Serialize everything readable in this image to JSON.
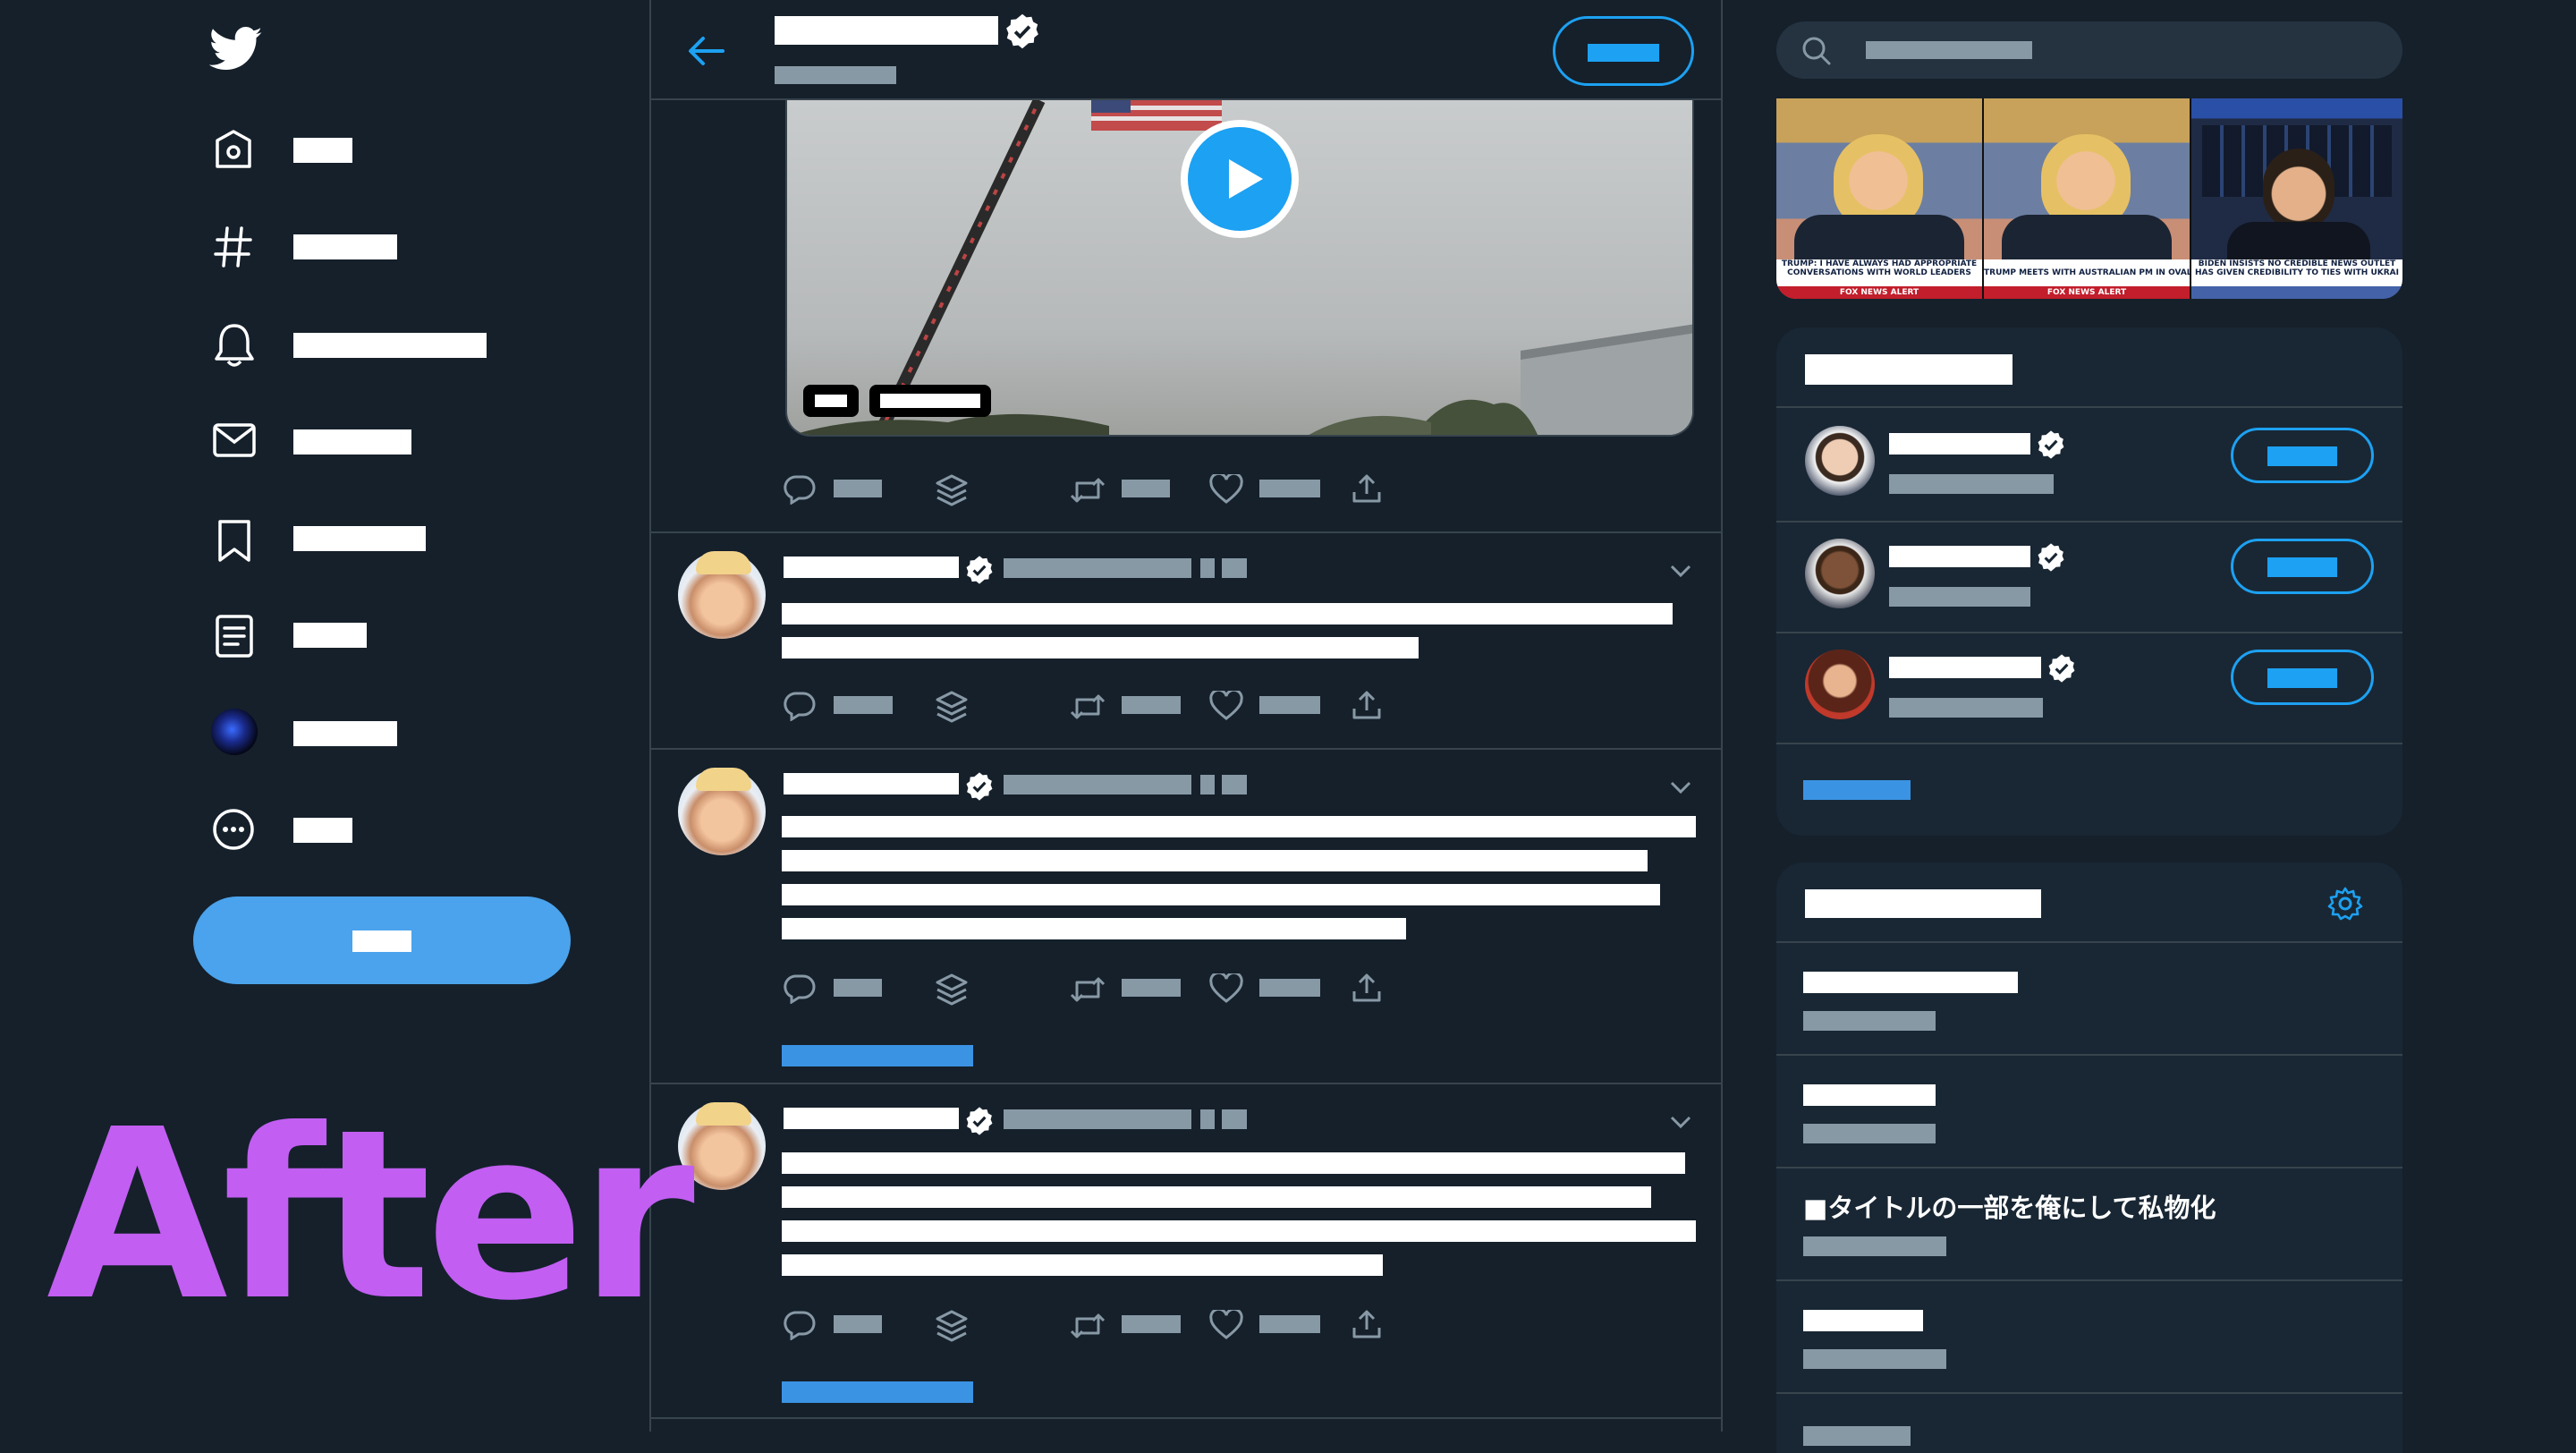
{
  "overlay": {
    "caption": "After",
    "caption_color": "#c25ef2"
  },
  "colors": {
    "background": "#15202b",
    "accent": "#1da1f2",
    "border": "#38444d",
    "muted": "#8899a6",
    "card": "#192734"
  },
  "nav": {
    "logo": "twitter-bird-icon",
    "items": [
      {
        "icon": "home-icon",
        "label": ""
      },
      {
        "icon": "hashtag-icon",
        "label": ""
      },
      {
        "icon": "bell-icon",
        "label": ""
      },
      {
        "icon": "mail-icon",
        "label": ""
      },
      {
        "icon": "bookmark-icon",
        "label": ""
      },
      {
        "icon": "list-icon",
        "label": ""
      },
      {
        "icon": "profile-avatar",
        "label": ""
      },
      {
        "icon": "more-icon",
        "label": ""
      }
    ],
    "tweet_button_label": ""
  },
  "header": {
    "back_icon": "arrow-left-icon",
    "display_name": "",
    "subtitle": "",
    "follow_label": ""
  },
  "video_card": {
    "play_icon": "play-icon"
  },
  "tweets": [
    {
      "name": "",
      "handle": "",
      "body": [
        ""
      ],
      "show_thread": ""
    },
    {
      "name": "",
      "handle": "",
      "body": [
        ""
      ],
      "show_thread": ""
    },
    {
      "name": "",
      "handle": "",
      "body": [
        ""
      ],
      "show_thread": ""
    }
  ],
  "right": {
    "search_placeholder": "",
    "media_strip": [
      {
        "caption": "TRUMP: I HAVE ALWAYS HAD APPROPRIATE CONVERSATIONS WITH WORLD LEADERS",
        "tag": "FOX NEWS ALERT"
      },
      {
        "caption": "TRUMP MEETS WITH AUSTRALIAN PM IN OVAL O",
        "tag": "FOX NEWS ALERT"
      },
      {
        "caption": "BIDEN INSISTS NO CREDIBLE NEWS OUTLET HAS GIVEN CREDIBILITY TO TIES WITH UKRAI",
        "tag": ""
      }
    ],
    "who_to_follow": {
      "title": "",
      "show_more": "",
      "users": [
        {
          "name": "",
          "handle": "",
          "follow": ""
        },
        {
          "name": "",
          "handle": "",
          "follow": ""
        },
        {
          "name": "",
          "handle": "",
          "follow": ""
        }
      ]
    },
    "trends": {
      "title": "",
      "settings_icon": "gear-icon",
      "items": [
        {
          "title": "",
          "meta": ""
        },
        {
          "title": "",
          "meta": ""
        },
        {
          "title": "■タイトルの一部を俺にして私物化",
          "meta": ""
        },
        {
          "title": "",
          "meta": ""
        }
      ]
    }
  }
}
